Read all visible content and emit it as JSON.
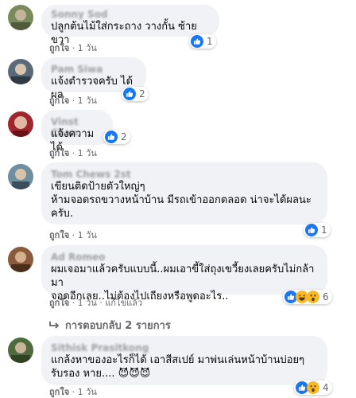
{
  "comments": [
    {
      "author": "Sonny Sod",
      "text": "ปลูกต้นไม้ใส่กระถาง วางกั้น ซ้ายขวา",
      "actions": {
        "like": "ถูกใจ",
        "reply": "ตอบกลับ",
        "time": "1 วัน",
        "extra": ""
      },
      "reactions": {
        "count": "1",
        "icons": [
          "like"
        ]
      }
    },
    {
      "author": "Pam Siwa",
      "text": "แจ้งตำรวจครับ ได้ผล",
      "actions": {
        "like": "ถูกใจ",
        "reply": "ตอบกลับ",
        "time": "1 วัน",
        "extra": ""
      },
      "reactions": {
        "count": "2",
        "icons": [
          "like"
        ]
      }
    },
    {
      "author": "Vinst Chan",
      "text": "แจ้งความได้",
      "actions": {
        "like": "ถูกใจ",
        "reply": "ตอบกลับ",
        "time": "1 วัน",
        "extra": ""
      },
      "reactions": {
        "count": "2",
        "icons": [
          "like"
        ]
      }
    },
    {
      "author": "Tom Chews 2st",
      "text": "เขียนติดป้ายตัวใหญ่ๆ\nห้ามจอดรถขวางหน้าบ้าน มีรถเข้าออกตลอด น่าจะได้ผลนะ\nครับ.",
      "actions": {
        "like": "ถูกใจ",
        "reply": "ตอบกลับ",
        "time": "1 วัน",
        "extra": ""
      },
      "reactions": {
        "count": "1",
        "icons": [
          "like"
        ]
      }
    },
    {
      "author": "Ad Romeo",
      "text": "ผมเจอมาแล้วครับแบบนี้..ผมเอาขี้ใส่ถุงเขวี้ยงเลยครับไม่กล้ามา\nจอดอีกเลย..ไม่ต้องไปเถียงหรือพูดอะไร..",
      "actions": {
        "like": "ถูกใจ",
        "reply": "ตอบกลับ",
        "time": "1 วัน",
        "extra": "แก้ไขแล้ว"
      },
      "reactions": {
        "count": "6",
        "icons": [
          "like",
          "haha",
          "wow"
        ]
      },
      "replies_label": "การตอบกลับ 2 รายการ"
    },
    {
      "author": "Sithisk Prasitkong",
      "text": "แกล้งหาของอะไรก็ได้ เอาสีสเปย์ มาพ่นเล่นหน้าบ้านบ่อยๆ\nรับรอง หาย.... 😈😈😈",
      "actions": {
        "like": "ถูกใจ",
        "reply": "ตอบกลับ",
        "time": "1 วัน",
        "extra": ""
      },
      "reactions": {
        "count": "4",
        "icons": [
          "like",
          "wow"
        ]
      }
    }
  ],
  "colors": {
    "bubble": "#f0f2f5",
    "like_blue": "#1877f2",
    "haha_yellow": "#f7b928",
    "meta_gray": "#65676b"
  }
}
